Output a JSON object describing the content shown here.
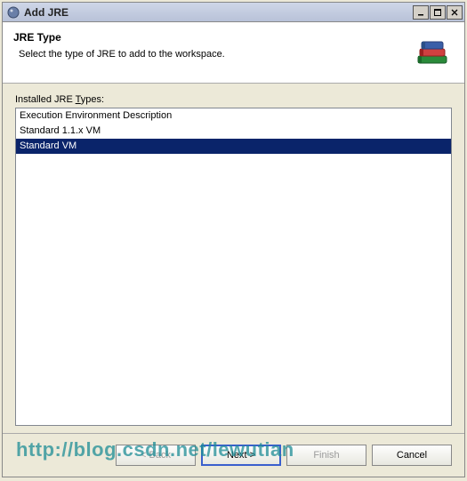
{
  "window": {
    "title": "Add JRE"
  },
  "header": {
    "title": "JRE Type",
    "subtitle": "Select the type of JRE to add to the workspace."
  },
  "list": {
    "label_prefix": "Installed JRE ",
    "label_mnemonic": "T",
    "label_suffix": "ypes:",
    "items": [
      {
        "label": "Execution Environment Description",
        "selected": false
      },
      {
        "label": "Standard 1.1.x VM",
        "selected": false
      },
      {
        "label": "Standard VM",
        "selected": true
      }
    ]
  },
  "footer": {
    "back_label": "< Back",
    "next_label": "Next >",
    "finish_label": "Finish",
    "cancel_label": "Cancel"
  },
  "watermark": "http://blog.csdn.net/lewutian"
}
